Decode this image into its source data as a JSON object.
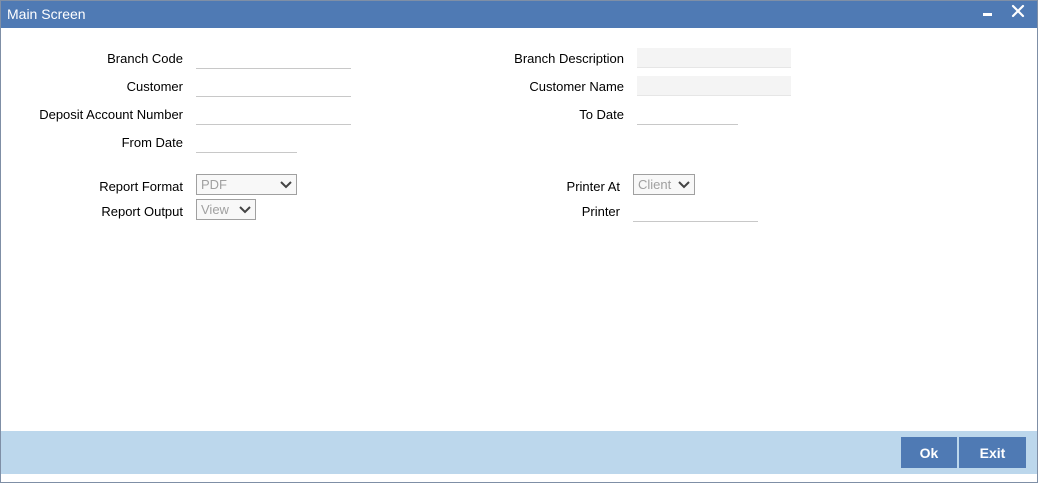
{
  "window": {
    "title": "Main Screen",
    "minimize_icon": "minimize-icon",
    "close_icon": "close-icon"
  },
  "form": {
    "branch_code": {
      "label": "Branch Code",
      "value": ""
    },
    "branch_description": {
      "label": "Branch Description",
      "value": ""
    },
    "customer": {
      "label": "Customer",
      "value": ""
    },
    "customer_name": {
      "label": "Customer Name",
      "value": ""
    },
    "deposit_account_number": {
      "label": "Deposit Account Number",
      "value": ""
    },
    "to_date": {
      "label": "To Date",
      "value": ""
    },
    "from_date": {
      "label": "From Date",
      "value": ""
    },
    "report_format": {
      "label": "Report Format",
      "selected": "PDF"
    },
    "printer_at": {
      "label": "Printer At",
      "selected": "Client"
    },
    "report_output": {
      "label": "Report Output",
      "selected": "View"
    },
    "printer": {
      "label": "Printer",
      "value": ""
    }
  },
  "footer": {
    "ok_label": "Ok",
    "exit_label": "Exit"
  },
  "colors": {
    "titlebar": "#4f7ab4",
    "footer": "#bcd7ec",
    "button": "#4f7ab4"
  }
}
